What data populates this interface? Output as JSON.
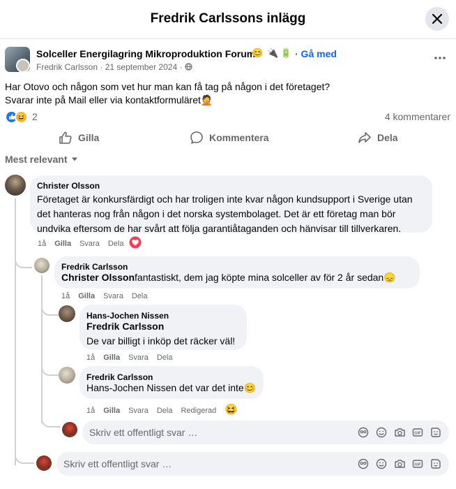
{
  "header": {
    "title": "Fredrik Carlssons inlägg"
  },
  "post": {
    "group_name": "Solceller Energilagring Mikroproduktion Forum",
    "group_emojis": [
      "😊",
      "🔌",
      "🔋"
    ],
    "join_label": "· Gå med",
    "author": "Fredrik Carlsson",
    "date": "21 september 2024",
    "text_line1": "Har Otovo och någon som vet hur man kan få tag på någon i det företaget?",
    "text_line2": "Svarar inte på Mail eller via kontaktformuläret",
    "text_emoji": "🤦",
    "reaction_count": "2",
    "comment_count": "4 kommentarer"
  },
  "actions": {
    "like": "Gilla",
    "comment": "Kommentera",
    "share": "Dela"
  },
  "filter_label": "Mest relevant",
  "comments": [
    {
      "author": "Christer Olsson",
      "text_lines": [
        "Företaget är konkursfärdigt och har troligen inte kvar någon kundsupport i Sverige utan",
        "det hanteras nog från någon i det norska systembolaget. Det är ett företag man bör",
        "undvika eftersom de har svårt att följa garantiåtaganden och hänvisar till tillverkaren."
      ],
      "time": "1å",
      "like": "Gilla",
      "reply": "Svara",
      "share": "Dela"
    },
    {
      "author": "Fredrik Carlsson",
      "mention": "Christer Olsson",
      "text": "fantastiskt, dem jag köpte mina solceller av för 2 år sedan",
      "emoji": "😞",
      "time": "1å",
      "like": "Gilla",
      "reply": "Svara",
      "share": "Dela"
    },
    {
      "author": "Hans-Jochen Nissen",
      "mention": "Fredrik Carlsson",
      "text": "De var billigt i inköp det räcker väl!",
      "time": "1å",
      "like": "Gilla",
      "reply": "Svara",
      "share": "Dela"
    },
    {
      "author": "Fredrik Carlsson",
      "text": "Hans-Jochen Nissen det var det inte",
      "emoji": "😊",
      "time": "1å",
      "like": "Gilla",
      "reply": "Svara",
      "share": "Dela",
      "edited": "Redigerad",
      "reaction_emoji": "😆"
    }
  ],
  "reply_placeholder": "Skriv ett offentligt svar …",
  "colors": {
    "accent": "#0866ff",
    "secondary_text": "#65676b",
    "bubble": "#f0f2f5"
  }
}
